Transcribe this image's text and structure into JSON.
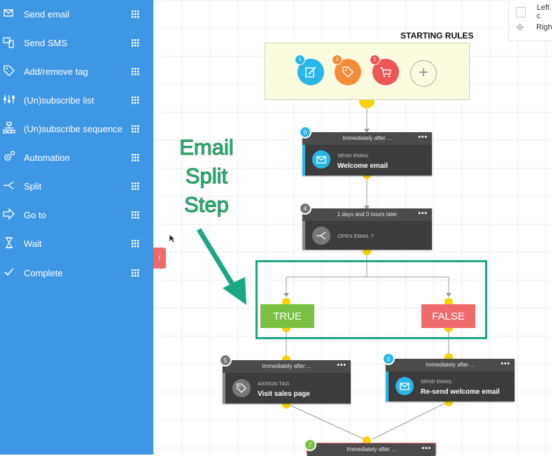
{
  "sidebar": {
    "items": [
      {
        "label": "Send email",
        "icon": "send-email-icon"
      },
      {
        "label": "Send SMS",
        "icon": "sms-icon"
      },
      {
        "label": "Add/remove tag",
        "icon": "tag-icon"
      },
      {
        "label": "(Un)subscribe list",
        "icon": "subscribe-list-icon"
      },
      {
        "label": "(Un)subscribe sequence",
        "icon": "sequence-icon"
      },
      {
        "label": "Automation",
        "icon": "gear-icon"
      },
      {
        "label": "Split",
        "icon": "split-icon"
      },
      {
        "label": "Go to",
        "icon": "arrow-right-icon"
      },
      {
        "label": "Wait",
        "icon": "hourglass-icon"
      },
      {
        "label": "Complete",
        "icon": "check-icon"
      }
    ]
  },
  "corner": {
    "left_label": "Left c",
    "right_label": "Righ"
  },
  "toggle_tab": {
    "label": "!"
  },
  "starting_rules": {
    "title": "STARTING RULES",
    "triggers": [
      {
        "badge": "1",
        "color": "#29b6e8",
        "icon": "edit-icon"
      },
      {
        "badge": "1",
        "color": "#f28c38",
        "icon": "tag-icon"
      },
      {
        "badge": "1",
        "color": "#ef5656",
        "icon": "cart-icon"
      }
    ],
    "add_label": "+"
  },
  "steps": {
    "s0": {
      "num": "0",
      "timing": "Immediately after ...",
      "type": "SEND EMAIL",
      "name": "Welcome email",
      "color": "#29b6e8"
    },
    "s4": {
      "num": "4",
      "timing": "1 days and 0 hours later",
      "type": "OPEN EMAIL ?",
      "name": "",
      "color": "#777777"
    },
    "s5": {
      "num": "5",
      "timing": "Immediately after ...",
      "type": "ASSIGN TAG",
      "name": "Visit sales page",
      "color": "#777777"
    },
    "s6": {
      "num": "6",
      "timing": "Immediately after ...",
      "type": "SEND EMAIL",
      "name": "Re-send welcome email",
      "color": "#29b6e8"
    },
    "s7": {
      "num": "7",
      "timing": "Immediately after ...",
      "color": "#7ac143"
    }
  },
  "step_menu": "•••",
  "branches": {
    "true_label": "TRUE",
    "false_label": "FALSE",
    "true_color": "#7ac143",
    "false_color": "#ef6a6a"
  },
  "annotation": {
    "line1": "Email",
    "line2": "Split",
    "line3": "Step",
    "color": "#27c07a"
  },
  "colors": {
    "sidebar": "#3f97e4",
    "connector": "#f5d200",
    "highlight": "#1aa784"
  }
}
